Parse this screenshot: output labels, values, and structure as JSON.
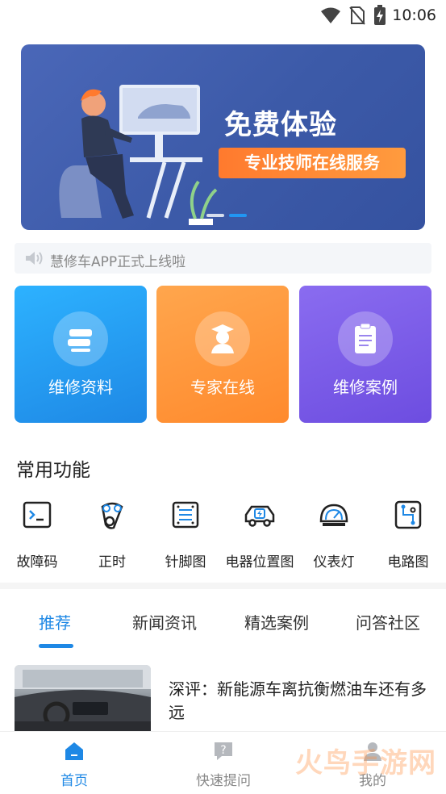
{
  "status": {
    "time": "10:06"
  },
  "banner": {
    "title": "免费体验",
    "subtitle": "专业技师在线服务"
  },
  "notice": {
    "text": "慧修车APP正式上线啦"
  },
  "cards": [
    {
      "label": "维修资料",
      "icon": "books-icon"
    },
    {
      "label": "专家在线",
      "icon": "expert-icon"
    },
    {
      "label": "维修案例",
      "icon": "clipboard-icon"
    }
  ],
  "functions": {
    "title": "常用功能",
    "items": [
      {
        "label": "故障码",
        "icon": "terminal-icon"
      },
      {
        "label": "正时",
        "icon": "timing-belt-icon"
      },
      {
        "label": "针脚图",
        "icon": "pin-diagram-icon"
      },
      {
        "label": "电器位置图",
        "icon": "car-electric-icon"
      },
      {
        "label": "仪表灯",
        "icon": "dashboard-icon"
      },
      {
        "label": "电路图",
        "icon": "circuit-icon"
      }
    ]
  },
  "tabs": [
    {
      "label": "推荐",
      "active": true
    },
    {
      "label": "新闻资讯"
    },
    {
      "label": "精选案例"
    },
    {
      "label": "问答社区"
    }
  ],
  "article": {
    "title": "深评：新能源车离抗衡燃油车还有多远"
  },
  "bottom_nav": [
    {
      "label": "首页",
      "active": true,
      "icon": "home-icon"
    },
    {
      "label": "快速提问",
      "icon": "question-icon"
    },
    {
      "label": "我的",
      "icon": "profile-icon"
    }
  ],
  "watermark": "火鸟手游网",
  "colors": {
    "accent": "#1e88e5",
    "orange": "#ff8a2d",
    "purple": "#6d4de0"
  }
}
